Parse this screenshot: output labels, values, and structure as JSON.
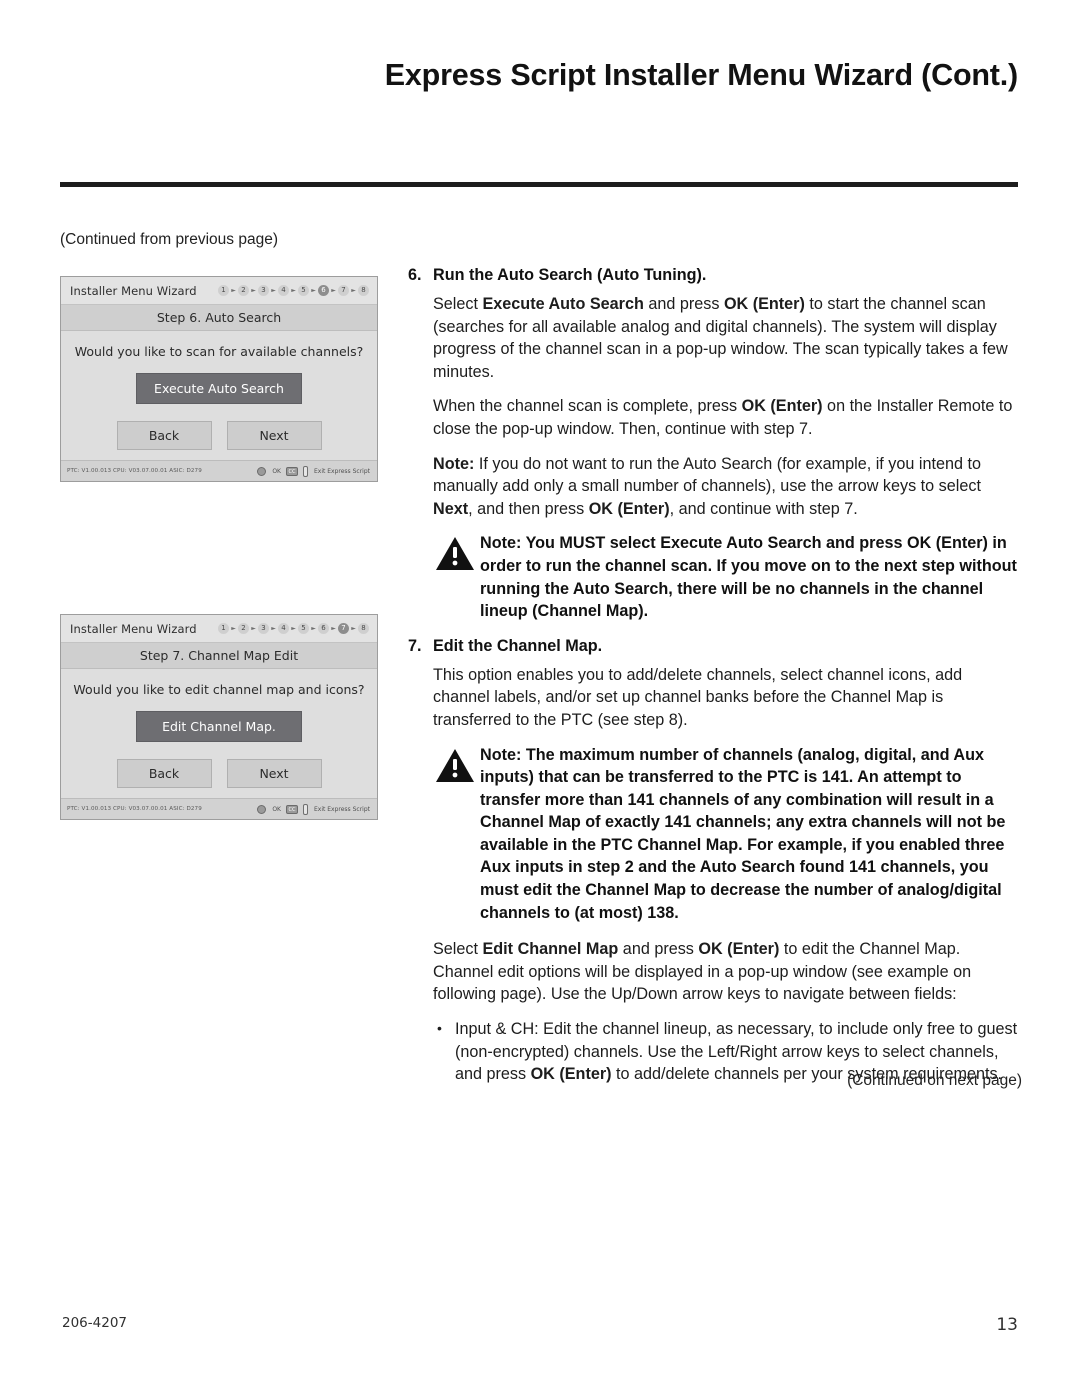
{
  "header": {
    "title": "Express Script Installer Menu Wizard (Cont.)"
  },
  "left_column": {
    "continued_from": "(Continued from previous page)"
  },
  "screenshots": [
    {
      "window_title": "Installer Menu Wizard",
      "steps": [
        "1",
        "2",
        "3",
        "4",
        "5",
        "6",
        "7",
        "8"
      ],
      "active_step": "6",
      "step_title": "Step 6. Auto Search",
      "question": "Would you like to scan for available channels?",
      "primary_button": "Execute Auto Search",
      "back_button": "Back",
      "next_button": "Next",
      "footer_version": "PTC: V1.00.013 CPU: V03.07.00.01 ASIC: D279",
      "footer_ok": "OK",
      "footer_cc": "CC",
      "footer_exit": "Exit Express Script"
    },
    {
      "window_title": "Installer Menu Wizard",
      "steps": [
        "1",
        "2",
        "3",
        "4",
        "5",
        "6",
        "7",
        "8"
      ],
      "active_step": "7",
      "step_title": "Step 7. Channel Map Edit",
      "question": "Would you like to edit channel map and icons?",
      "primary_button": "Edit Channel Map.",
      "back_button": "Back",
      "next_button": "Next",
      "footer_version": "PTC: V1.00.013 CPU: V03.07.00.01 ASIC: D279",
      "footer_ok": "OK",
      "footer_cc": "CC",
      "footer_exit": "Exit Express Script"
    }
  ],
  "body": {
    "step6": {
      "number": "6.",
      "heading": "Run the Auto Search (Auto Tuning).",
      "p1_a": "Select ",
      "p1_b": "Execute Auto Search",
      "p1_c": " and press ",
      "p1_d": "OK (Enter)",
      "p1_e": " to start the channel scan (searches for all available analog and digital channels). The system will display progress of the channel scan in a pop-up window. The scan typically takes a few minutes.",
      "p2_a": "When the channel scan is complete, press ",
      "p2_b": "OK (Enter)",
      "p2_c": " on the Installer Remote to close the pop-up window. Then, continue with step 7.",
      "p3_a": "Note:",
      "p3_b": " If you do not want to run the Auto Search (for example, if you intend to manually add only a small number of channels), use the arrow keys to select ",
      "p3_c": "Next",
      "p3_d": ", and then press ",
      "p3_e": "OK (Enter)",
      "p3_f": ", and continue with step 7.",
      "note": "Note: You MUST select Execute Auto Search and press OK (Enter) in order to run the channel scan. If you move on to the next step without running the Auto Search, there will be no channels in the channel lineup (Channel Map)."
    },
    "step7": {
      "number": "7.",
      "heading": "Edit the Channel Map.",
      "p1": "This option enables you to add/delete channels, select channel icons, add channel labels, and/or set up channel banks before the Channel Map is transferred to the PTC (see step 8).",
      "note": "Note: The maximum number of channels (analog, digital, and Aux inputs) that can be transferred to the PTC is 141. An attempt to transfer more than 141 channels of any combination will result in a Channel Map of exactly 141 channels; any extra channels will not be available in the PTC Channel Map. For example, if you enabled three Aux inputs in step 2 and the Auto Search found 141 channels, you must edit the Channel Map to decrease the number of analog/digital channels to (at most) 138.",
      "p2_a": "Select ",
      "p2_b": "Edit Channel Map",
      "p2_c": " and press ",
      "p2_d": "OK (Enter)",
      "p2_e": " to edit the Channel Map. Channel edit options will be displayed in a pop-up window (see example on following page). Use the Up/Down arrow keys to navigate between fields:",
      "bullet1_a": "Input & CH: Edit the channel lineup, as necessary, to include only free to guest (non-encrypted) channels. Use the Left/Right arrow keys to select channels, and press ",
      "bullet1_b": "OK (Enter)",
      "bullet1_c": " to add/delete channels per your system requirements."
    },
    "continued_on_next": "(Continued on next page)"
  },
  "footer": {
    "doc_number": "206-4207",
    "page_number": "13"
  }
}
